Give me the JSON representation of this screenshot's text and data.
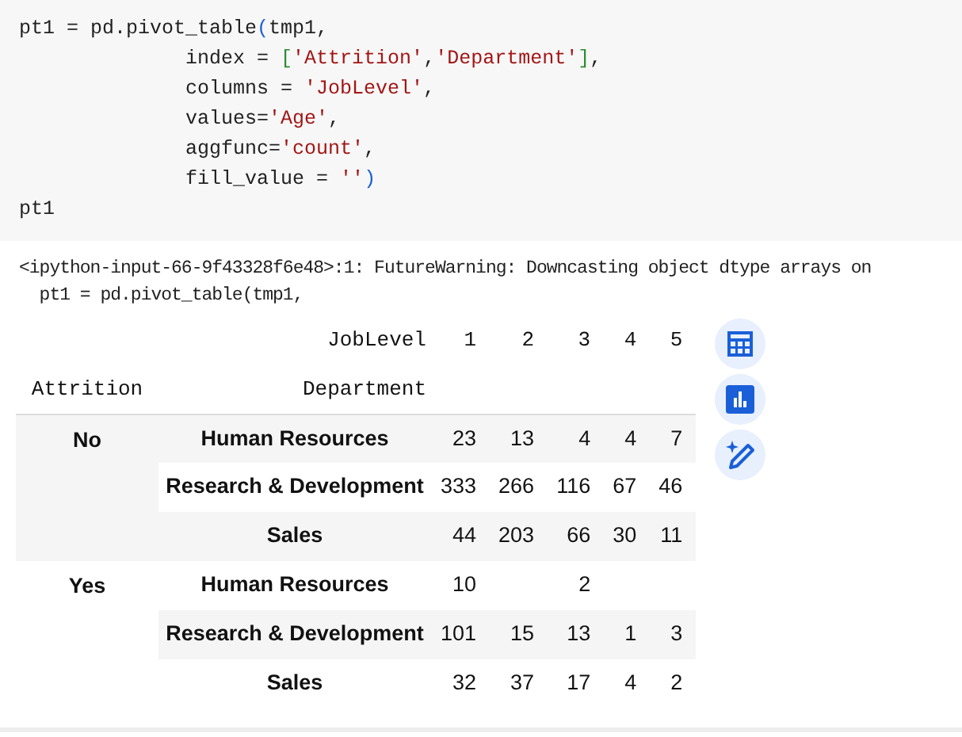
{
  "code_cell": {
    "lines": [
      {
        "tokens": [
          {
            "kind": "plain",
            "text": "pt1 = pd.pivot_table"
          },
          {
            "kind": "paren",
            "text": "("
          },
          {
            "kind": "plain",
            "text": "tmp1,"
          }
        ]
      },
      {
        "tokens": [
          {
            "kind": "plain",
            "text": "              index = "
          },
          {
            "kind": "bracket",
            "text": "["
          },
          {
            "kind": "string",
            "text": "'Attrition'"
          },
          {
            "kind": "plain",
            "text": ","
          },
          {
            "kind": "string",
            "text": "'Department'"
          },
          {
            "kind": "bracket",
            "text": "]"
          },
          {
            "kind": "plain",
            "text": ","
          }
        ]
      },
      {
        "tokens": [
          {
            "kind": "plain",
            "text": "              columns = "
          },
          {
            "kind": "string",
            "text": "'JobLevel'"
          },
          {
            "kind": "plain",
            "text": ","
          }
        ]
      },
      {
        "tokens": [
          {
            "kind": "plain",
            "text": "              values="
          },
          {
            "kind": "string",
            "text": "'Age'"
          },
          {
            "kind": "plain",
            "text": ","
          }
        ]
      },
      {
        "tokens": [
          {
            "kind": "plain",
            "text": "              aggfunc="
          },
          {
            "kind": "string",
            "text": "'count'"
          },
          {
            "kind": "plain",
            "text": ","
          }
        ]
      },
      {
        "tokens": [
          {
            "kind": "plain",
            "text": "              fill_value = "
          },
          {
            "kind": "string",
            "text": "''"
          },
          {
            "kind": "paren",
            "text": ")"
          }
        ]
      },
      {
        "tokens": [
          {
            "kind": "plain",
            "text": "pt1"
          }
        ]
      }
    ]
  },
  "output": {
    "warning_lines": [
      "<ipython-input-66-9f43328f6e48>:1: FutureWarning: Downcasting object dtype arrays on",
      "  pt1 = pd.pivot_table(tmp1,"
    ],
    "table": {
      "columns_label": "JobLevel",
      "columns": [
        "1",
        "2",
        "3",
        "4",
        "5"
      ],
      "index_names": [
        "Attrition",
        "Department"
      ],
      "groups": [
        {
          "attrition": "No",
          "rows": [
            {
              "department": "Human Resources",
              "cells": [
                {
                  "text": "23"
                },
                {
                  "text": "13"
                },
                {
                  "text": "4"
                },
                {
                  "text": "4"
                },
                {
                  "text": "7"
                }
              ]
            },
            {
              "department": "Research & Development",
              "cells": [
                {
                  "text": "333"
                },
                {
                  "text": "266"
                },
                {
                  "text": "116"
                },
                {
                  "text": "67"
                },
                {
                  "text": "46"
                }
              ]
            },
            {
              "department": "Sales",
              "cells": [
                {
                  "text": "44"
                },
                {
                  "text": "203"
                },
                {
                  "text": "66"
                },
                {
                  "text": "30"
                },
                {
                  "text": "11"
                }
              ]
            }
          ]
        },
        {
          "attrition": "Yes",
          "rows": [
            {
              "department": "Human Resources",
              "cells": [
                {
                  "text": "10"
                },
                {},
                {
                  "text": "2"
                },
                {},
                {}
              ]
            },
            {
              "department": "Research & Development",
              "cells": [
                {
                  "text": "101"
                },
                {
                  "text": "15"
                },
                {
                  "text": "13"
                },
                {
                  "text": "1"
                },
                {
                  "text": "3"
                }
              ]
            },
            {
              "department": "Sales",
              "cells": [
                {
                  "text": "32"
                },
                {
                  "text": "37"
                },
                {
                  "text": "17"
                },
                {
                  "text": "4"
                },
                {
                  "text": "2"
                }
              ]
            }
          ]
        }
      ]
    },
    "actions": [
      {
        "kind": "table"
      },
      {
        "kind": "chart"
      },
      {
        "kind": "magic"
      }
    ]
  }
}
